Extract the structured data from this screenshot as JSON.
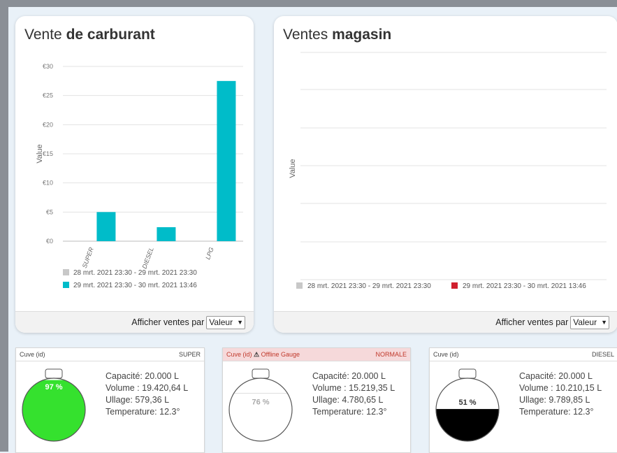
{
  "fuel_card": {
    "title_prefix": "Vente ",
    "title_bold": "de carburant",
    "footer_label": "Afficher ventes par",
    "select_value": "Valeur"
  },
  "shop_card": {
    "title_prefix": "Ventes ",
    "title_bold": "magasin",
    "footer_label": "Afficher ventes par",
    "select_value": "Valeur",
    "ylabel": "Value"
  },
  "chart_data": [
    {
      "type": "bar",
      "categories": [
        "SUPER",
        "DIESEL",
        "LPG"
      ],
      "series": [
        {
          "name": "28 mrt. 2021 23:30 - 29 mrt. 2021 23:30",
          "values": [
            0,
            0,
            0
          ],
          "color": "#c8c8c8"
        },
        {
          "name": "29 mrt. 2021 23:30 - 30 mrt. 2021 13:46",
          "values": [
            5,
            2.4,
            27.5
          ],
          "color": "#00bcc9"
        }
      ],
      "ylabel": "Value",
      "ylim": [
        0,
        30
      ],
      "yticks": [
        "€0",
        "€5",
        "€10",
        "€15",
        "€20",
        "€25",
        "€30"
      ],
      "grid": true,
      "legend": "bottom"
    },
    {
      "type": "bar",
      "categories": [],
      "series": [
        {
          "name": "28 mrt. 2021 23:30 - 29 mrt. 2021 23:30",
          "values": [],
          "color": "#c8c8c8"
        },
        {
          "name": "29 mrt. 2021 23:30 - 30 mrt. 2021 13:46",
          "values": [],
          "color": "#d0202e"
        }
      ],
      "ylabel": "Value",
      "grid": true,
      "legend": "bottom"
    }
  ],
  "tanks": [
    {
      "head_left": "Cuve (id)",
      "head_right": "SUPER",
      "warning": "",
      "percent": 97,
      "percent_label": "97 %",
      "fill_color": "#35e12e",
      "capacity": "Capacité: 20.000 L",
      "volume": "Volume : 19.420,64 L",
      "ullage": "Ullage: 579,36 L",
      "temperature": "Temperature: 12.3°"
    },
    {
      "head_left": "Cuve (id)",
      "head_right": "NORMALE",
      "warning": "Offline Gauge",
      "percent": 76,
      "percent_label": "76 %",
      "fill_color": "#ffffff",
      "capacity": "Capacité: 20.000 L",
      "volume": "Volume : 15.219,35 L",
      "ullage": "Ullage: 4.780,65 L",
      "temperature": "Temperature: 12.3°"
    },
    {
      "head_left": "Cuve (id)",
      "head_right": "DIESEL",
      "warning": "",
      "percent": 51,
      "percent_label": "51 %",
      "fill_color": "#000000",
      "capacity": "Capacité: 20.000 L",
      "volume": "Volume : 10.210,15 L",
      "ullage": "Ullage: 9.789,85 L",
      "temperature": "Temperature: 12.3°"
    }
  ]
}
